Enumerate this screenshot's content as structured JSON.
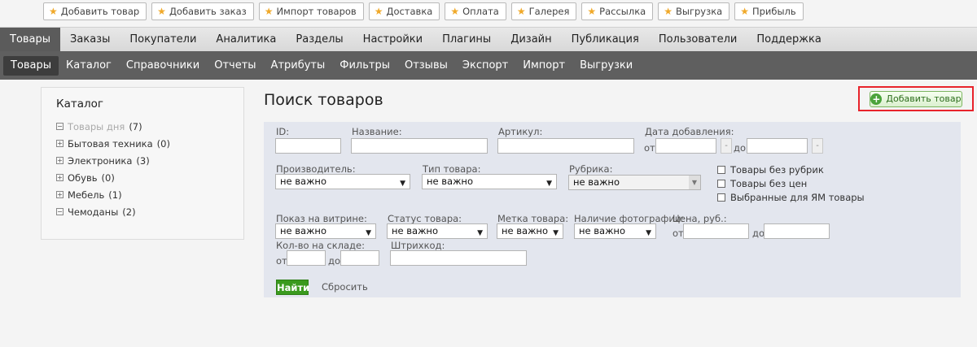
{
  "quickbar": [
    "Добавить товар",
    "Добавить заказ",
    "Импорт товаров",
    "Доставка",
    "Оплата",
    "Галерея",
    "Рассылка",
    "Выгрузка",
    "Прибыль"
  ],
  "mainnav": [
    "Товары",
    "Заказы",
    "Покупатели",
    "Аналитика",
    "Разделы",
    "Настройки",
    "Плагины",
    "Дизайн",
    "Публикация",
    "Пользователи",
    "Поддержка"
  ],
  "subnav": [
    "Товары",
    "Каталог",
    "Справочники",
    "Отчеты",
    "Атрибуты",
    "Фильтры",
    "Отзывы",
    "Экспорт",
    "Импорт",
    "Выгрузки"
  ],
  "catalog": {
    "title": "Каталог",
    "items": [
      {
        "name": "Товары дня",
        "count": "(7)",
        "toggle": "−"
      },
      {
        "name": "Бытовая техника",
        "count": "(0)",
        "toggle": "+"
      },
      {
        "name": "Электроника",
        "count": "(3)",
        "toggle": "+"
      },
      {
        "name": "Обувь",
        "count": "(0)",
        "toggle": "+"
      },
      {
        "name": "Мебель",
        "count": "(1)",
        "toggle": "+"
      },
      {
        "name": "Чемоданы",
        "count": "(2)",
        "toggle": "−"
      }
    ]
  },
  "page_title": "Поиск товаров",
  "add_button": "Добавить товар",
  "form": {
    "id_label": "ID:",
    "name_label": "Название:",
    "sku_label": "Артикул:",
    "date_label": "Дата добавления:",
    "from": "от",
    "to": "до",
    "dash": "-",
    "manufacturer_label": "Производитель:",
    "type_label": "Тип товара:",
    "rubric_label": "Рубрика:",
    "any": "не важно",
    "chk_no_rubric": "Товары без рубрик",
    "chk_no_price": "Товары без цен",
    "chk_ym": "Выбранные для ЯМ товары",
    "showcase_label": "Показ на витрине:",
    "status_label": "Статус товара:",
    "mark_label": "Метка товара:",
    "photo_label": "Наличие фотографии:",
    "price_label": "Цена, руб.:",
    "stock_label": "Кол-во на складе:",
    "barcode_label": "Штрихкод:",
    "find": "Найти",
    "reset": "Сбросить"
  }
}
